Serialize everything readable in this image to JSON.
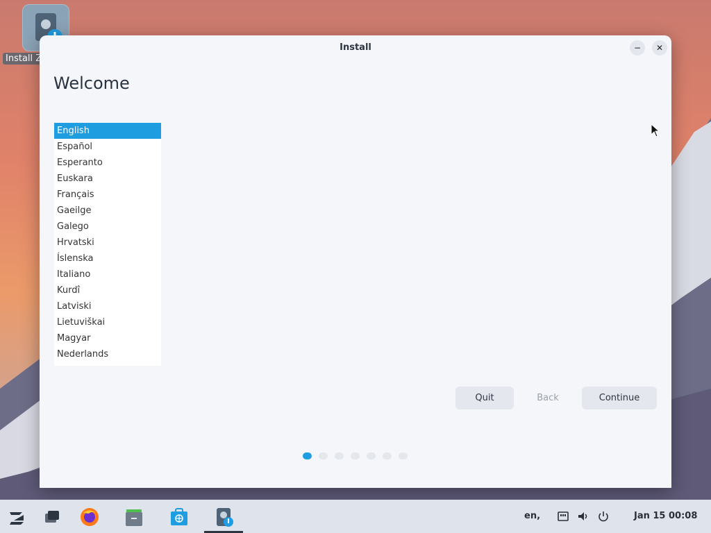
{
  "desktop": {
    "install_icon_label": "Install Z"
  },
  "window": {
    "title": "Install",
    "minimize_label": "−",
    "close_label": "✕",
    "heading": "Welcome",
    "languages": [
      "English",
      "Español",
      "Esperanto",
      "Euskara",
      "Français",
      "Gaeilge",
      "Galego",
      "Hrvatski",
      "Íslenska",
      "Italiano",
      "Kurdî",
      "Latviski",
      "Lietuviškai",
      "Magyar",
      "Nederlands"
    ],
    "selected_language": "English",
    "buttons": {
      "quit": "Quit",
      "back": "Back",
      "continue": "Continue"
    },
    "progress_step": 1,
    "progress_total": 7
  },
  "taskbar": {
    "keyboard_layout": "en,",
    "clock": "Jan 15  00:08"
  },
  "colors": {
    "accent": "#1e9de0",
    "window_bg": "#f4f6fa",
    "taskbar_bg": "#dfe4ec"
  }
}
